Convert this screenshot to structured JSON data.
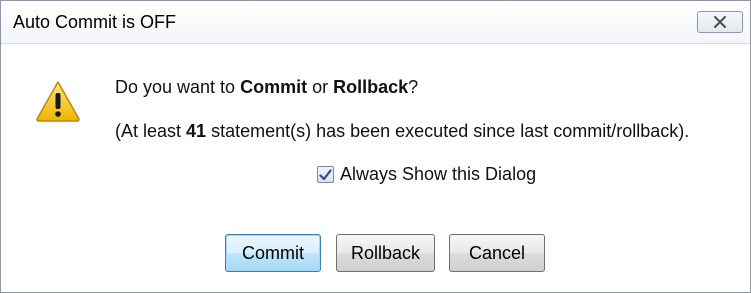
{
  "window": {
    "title": "Auto Commit is OFF",
    "close_symbol": "✕"
  },
  "message": {
    "line1_prefix": "Do you want to ",
    "line1_commit": "Commit",
    "line1_or": " or ",
    "line1_rollback": "Rollback",
    "line1_suffix": "?",
    "line2_prefix": "(At least ",
    "line2_count": "41",
    "line2_suffix": " statement(s) has been executed since last commit/rollback)."
  },
  "checkbox": {
    "label": "Always Show this Dialog",
    "checked": true
  },
  "buttons": {
    "commit": "Commit",
    "rollback": "Rollback",
    "cancel": "Cancel"
  },
  "icons": {
    "warning": "warning-icon",
    "close": "close-icon",
    "check": "checkmark-icon"
  }
}
